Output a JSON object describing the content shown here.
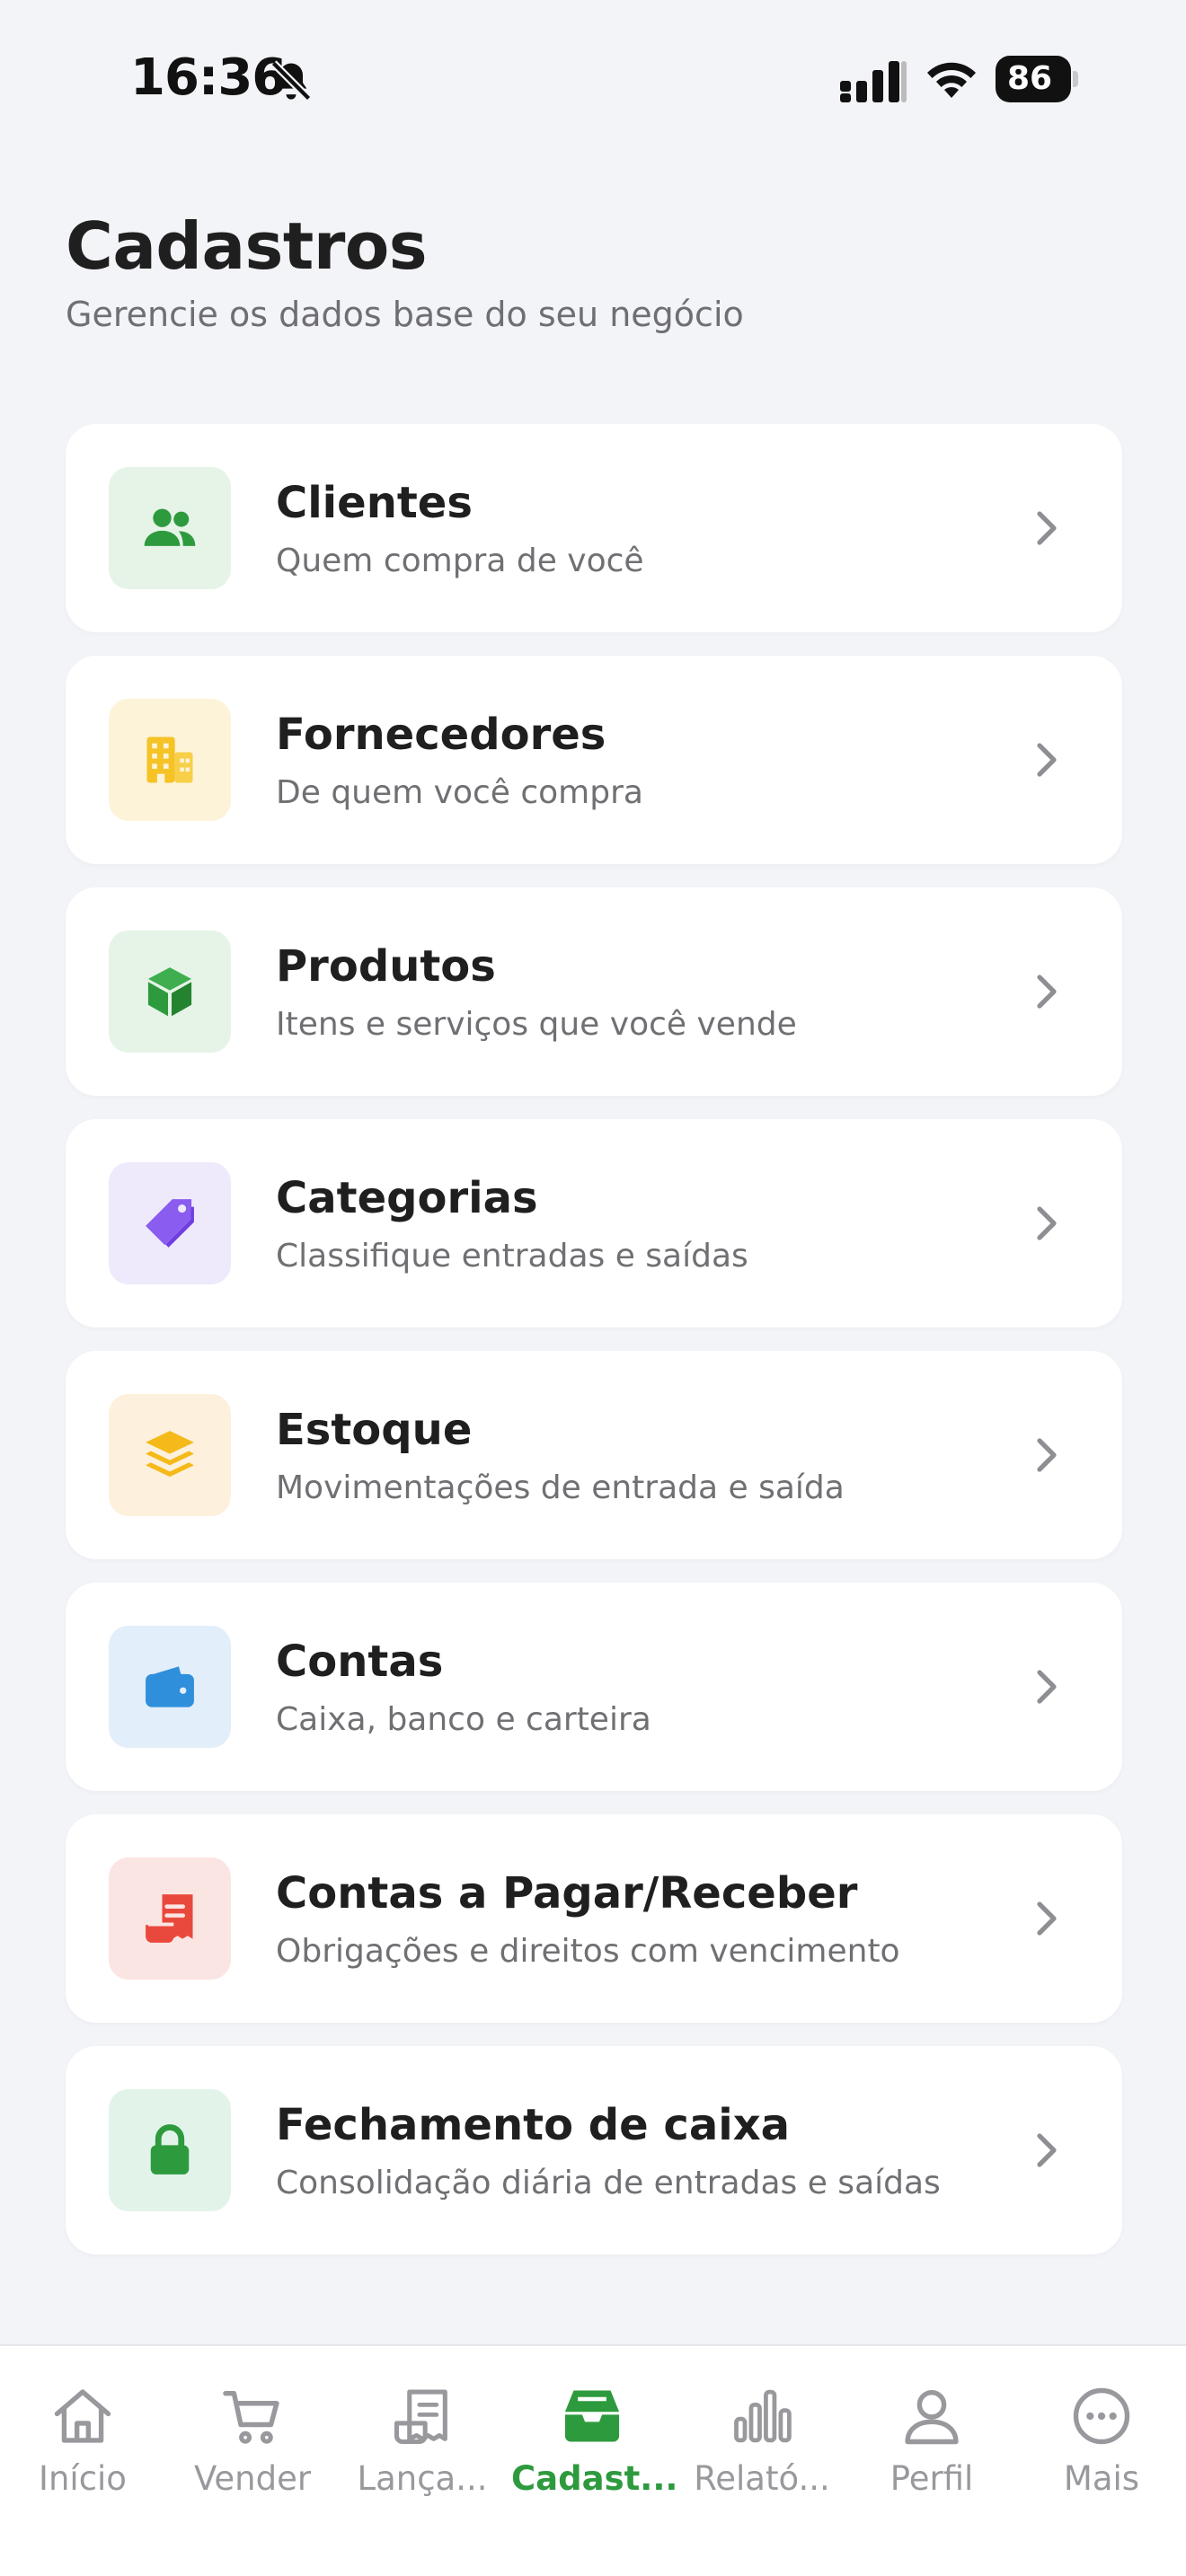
{
  "status_bar": {
    "time": "16:36",
    "battery": "86"
  },
  "header": {
    "title": "Cadastros",
    "subtitle": "Gerencie os dados base do seu negócio"
  },
  "items": [
    {
      "title": "Clientes",
      "desc": "Quem compra de você",
      "icon": "users-icon",
      "color": "#2e9a3e",
      "bg": "#e6f4e8"
    },
    {
      "title": "Fornecedores",
      "desc": "De quem você compra",
      "icon": "building-icon",
      "color": "#f5c325",
      "bg": "#fdf3d9"
    },
    {
      "title": "Produtos",
      "desc": "Itens e serviços que você vende",
      "icon": "cube-icon",
      "color": "#2e9a3e",
      "bg": "#e6f4e8"
    },
    {
      "title": "Categorias",
      "desc": "Classifique entradas e saídas",
      "icon": "tag-icon",
      "color": "#8a5cf0",
      "bg": "#efe9fc"
    },
    {
      "title": "Estoque",
      "desc": "Movimentações de entrada e saída",
      "icon": "layers-icon",
      "color": "#f5b91a",
      "bg": "#fdf1dd"
    },
    {
      "title": "Contas",
      "desc": "Caixa, banco e carteira",
      "icon": "wallet-icon",
      "color": "#2f8fdb",
      "bg": "#e2eefa"
    },
    {
      "title": "Contas a Pagar/Receber",
      "desc": "Obrigações e direitos com vencimento",
      "icon": "receipt-icon",
      "color": "#e9493c",
      "bg": "#fbe5e3"
    },
    {
      "title": "Fechamento de caixa",
      "desc": "Consolidação diária de entradas e saídas",
      "icon": "lock-icon",
      "color": "#2e9a3e",
      "bg": "#e2f4ea"
    }
  ],
  "tabs": [
    {
      "label": "Início",
      "icon": "home-icon",
      "active": false
    },
    {
      "label": "Vender",
      "icon": "cart-icon",
      "active": false
    },
    {
      "label": "Lança...",
      "icon": "receipt-list-icon",
      "active": false
    },
    {
      "label": "Cadast...",
      "icon": "inbox-icon",
      "active": true
    },
    {
      "label": "Relató...",
      "icon": "bar-chart-icon",
      "active": false
    },
    {
      "label": "Perfil",
      "icon": "person-icon",
      "active": false
    },
    {
      "label": "Mais",
      "icon": "more-icon",
      "active": false
    }
  ],
  "colors": {
    "accent": "#2e9a3e",
    "inactive_tab": "#98989d"
  }
}
